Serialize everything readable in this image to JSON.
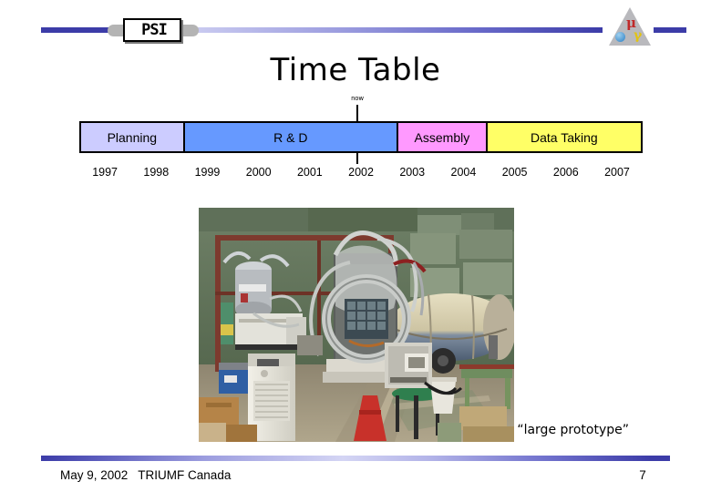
{
  "header": {
    "psi_logo_text": "PSI",
    "meg_logo": {
      "mu_symbol": "μ",
      "gamma_symbol": "γ"
    }
  },
  "title": "Time Table",
  "now_marker": {
    "label": "now"
  },
  "timeline": {
    "phases": [
      {
        "label": "Planning",
        "color": "#ccccff",
        "span_years": 2.0
      },
      {
        "label": "R & D",
        "color": "#6699ff",
        "span_years": 4.2
      },
      {
        "label": "Assembly",
        "color": "#ff99ff",
        "span_years": 1.75
      },
      {
        "label": "Data Taking",
        "color": "#ffff66",
        "span_years": 3.05
      }
    ],
    "years": [
      "1997",
      "1998",
      "1999",
      "2000",
      "2001",
      "2002",
      "2003",
      "2004",
      "2005",
      "2006",
      "2007"
    ]
  },
  "photo": {
    "caption": "“large prototype”",
    "alt": "photograph of large prototype detector apparatus in a laboratory hall"
  },
  "footer": {
    "text": "May 9, 2002   TRIUMF Canada",
    "page_number": "7"
  }
}
